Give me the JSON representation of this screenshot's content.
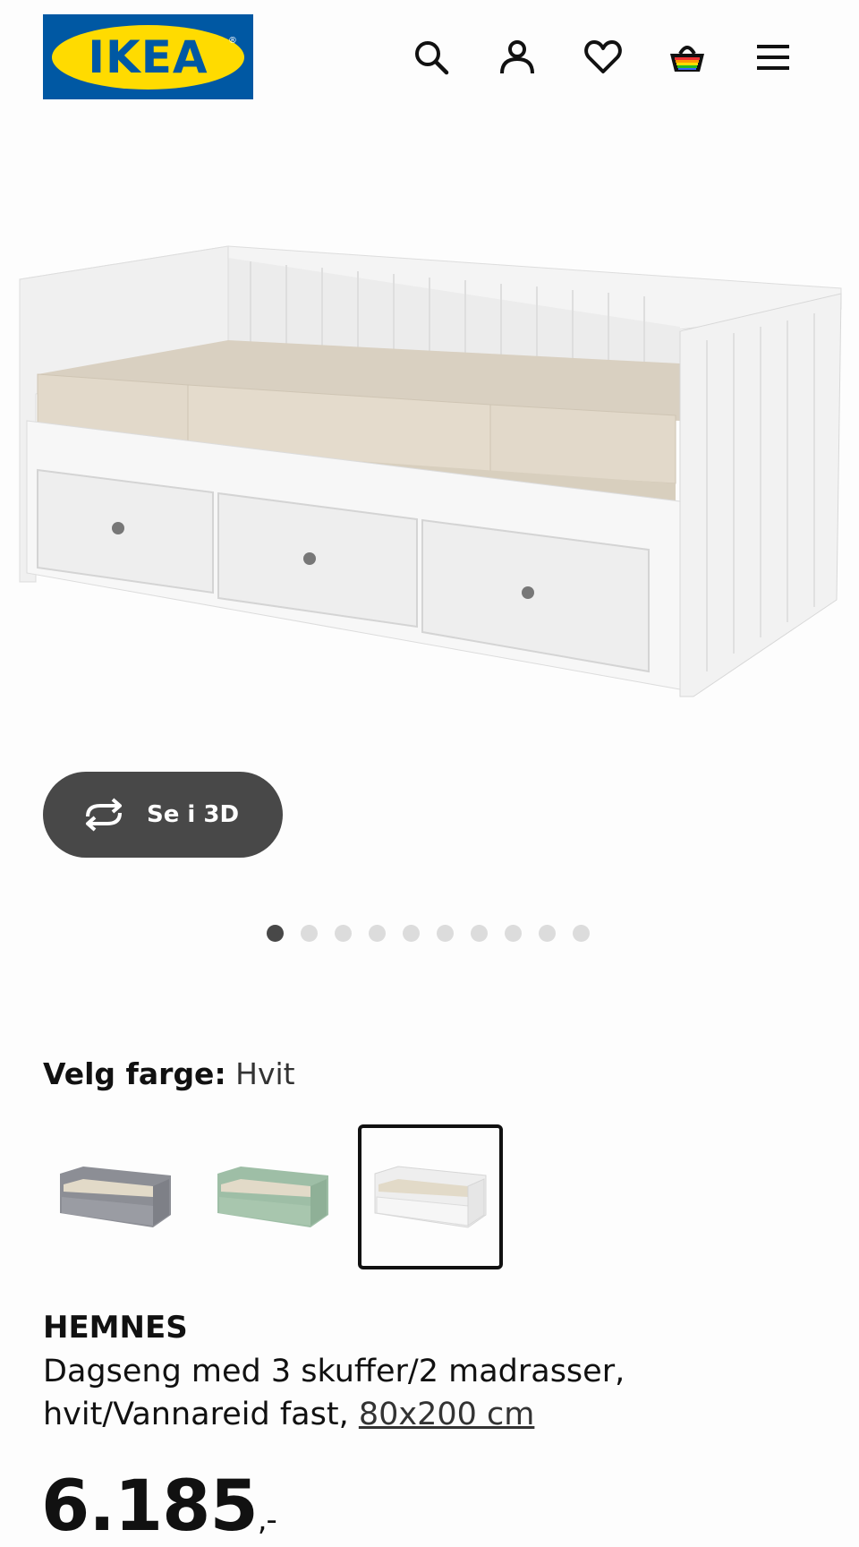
{
  "header": {
    "logo_text": "IKEA",
    "icons": [
      "search-icon",
      "account-icon",
      "heart-icon",
      "basket-icon",
      "menu-icon"
    ]
  },
  "gallery": {
    "view_3d_label": "Se i 3D",
    "image_count": 10,
    "active_index": 1
  },
  "color": {
    "label": "Velg farge:",
    "selected_value": "Hvit",
    "options": [
      "grey",
      "green",
      "white"
    ],
    "selected_option": "white"
  },
  "product": {
    "name": "HEMNES",
    "description_line1": "Dagseng med 3 skuffer/2 madrasser,",
    "description_line2": "hvit/Vannareid fast,",
    "size_link": "80x200 cm",
    "price_main": "6.185",
    "price_suffix": ",-"
  },
  "colors": {
    "ikea_blue": "#0058a3",
    "ikea_yellow": "#ffdb00",
    "button_dark": "#484848"
  }
}
